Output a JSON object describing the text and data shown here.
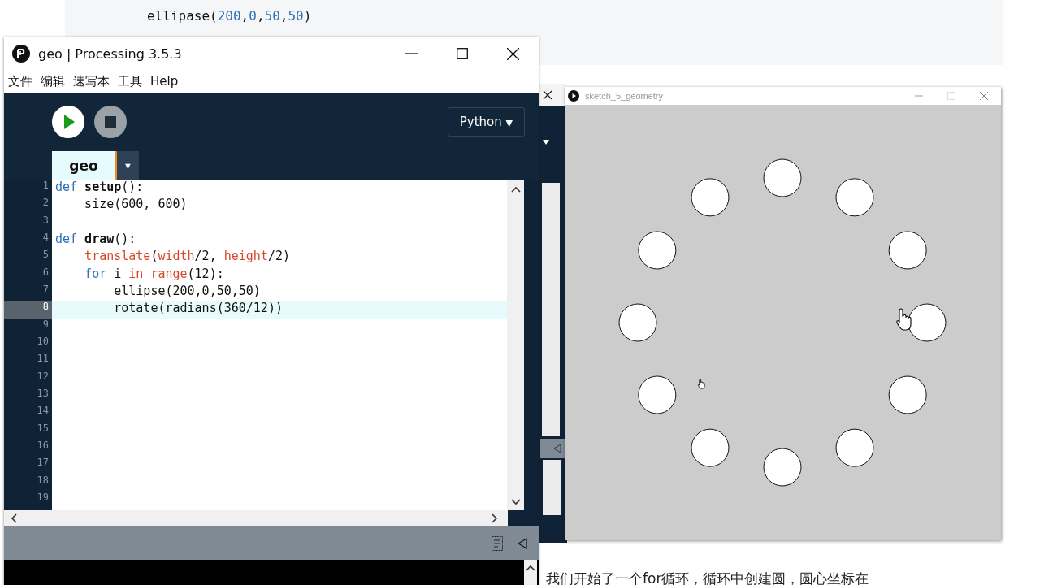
{
  "background_page": {
    "code_line": [
      {
        "t": "ellipase(",
        "kind": "plain"
      },
      {
        "t": "200",
        "kind": "num"
      },
      {
        "t": ",",
        "kind": "plain"
      },
      {
        "t": "0",
        "kind": "num"
      },
      {
        "t": ",",
        "kind": "plain"
      },
      {
        "t": "50",
        "kind": "num"
      },
      {
        "t": ",",
        "kind": "plain"
      },
      {
        "t": "50",
        "kind": "num"
      },
      {
        "t": ")",
        "kind": "plain"
      }
    ],
    "paragraph": "我们开始了一个for循环，循环中创建圆，圆心坐标在"
  },
  "editor_window": {
    "title": "geo | Processing 3.5.3",
    "menu": [
      "文件",
      "编辑",
      "速写本",
      "工具",
      "Help"
    ],
    "mode": "Python",
    "mode_caret": "▼",
    "tabs": [
      {
        "label": "geo",
        "selected": true
      }
    ],
    "tab_menu": "▼",
    "lines": [
      {
        "number": "1",
        "selected": false,
        "tokens": [
          {
            "t": "def",
            "kind": "kw"
          },
          {
            "t": " setup",
            "kind": "fn"
          },
          {
            "t": "():",
            "kind": "plain"
          }
        ]
      },
      {
        "number": "2",
        "selected": false,
        "tokens": [
          {
            "t": "    size(600, 600)",
            "kind": "plain"
          }
        ]
      },
      {
        "number": "3",
        "selected": false
      },
      {
        "number": "4",
        "selected": false,
        "tokens": [
          {
            "t": "def",
            "kind": "kw"
          },
          {
            "t": " draw",
            "kind": "fn"
          },
          {
            "t": "():",
            "kind": "plain"
          }
        ]
      },
      {
        "number": "5",
        "selected": false,
        "tokens": [
          {
            "t": "    translate",
            "kind": "builtin"
          },
          {
            "t": "(",
            "kind": "plain"
          },
          {
            "t": "width",
            "kind": "builtin"
          },
          {
            "t": "/2, ",
            "kind": "plain"
          },
          {
            "t": "height",
            "kind": "builtin"
          },
          {
            "t": "/2)",
            "kind": "plain"
          }
        ]
      },
      {
        "number": "6",
        "selected": false,
        "tokens": [
          {
            "t": "    for",
            "kind": "kw"
          },
          {
            "t": " i ",
            "kind": "plain"
          },
          {
            "t": "in",
            "kind": "builtin"
          },
          {
            "t": " range",
            "kind": "builtin"
          },
          {
            "t": "(12):",
            "kind": "plain"
          }
        ]
      },
      {
        "number": "7",
        "selected": false,
        "tokens": [
          {
            "t": "        ellipse(200,0,50,50)",
            "kind": "plain"
          }
        ]
      },
      {
        "number": "8",
        "selected": true,
        "tokens": [
          {
            "t": "        rotate(radians(360/12))",
            "kind": "plain"
          }
        ]
      },
      {
        "number": "9",
        "selected": false
      },
      {
        "number": "10",
        "selected": false
      },
      {
        "number": "11",
        "selected": false
      },
      {
        "number": "12",
        "selected": false
      },
      {
        "number": "13",
        "selected": false
      },
      {
        "number": "14",
        "selected": false
      },
      {
        "number": "15",
        "selected": false
      },
      {
        "number": "16",
        "selected": false
      },
      {
        "number": "17",
        "selected": false
      },
      {
        "number": "18",
        "selected": false
      },
      {
        "number": "19",
        "selected": false
      }
    ]
  },
  "sketch_window": {
    "title": "sketch_5_geometry"
  }
}
